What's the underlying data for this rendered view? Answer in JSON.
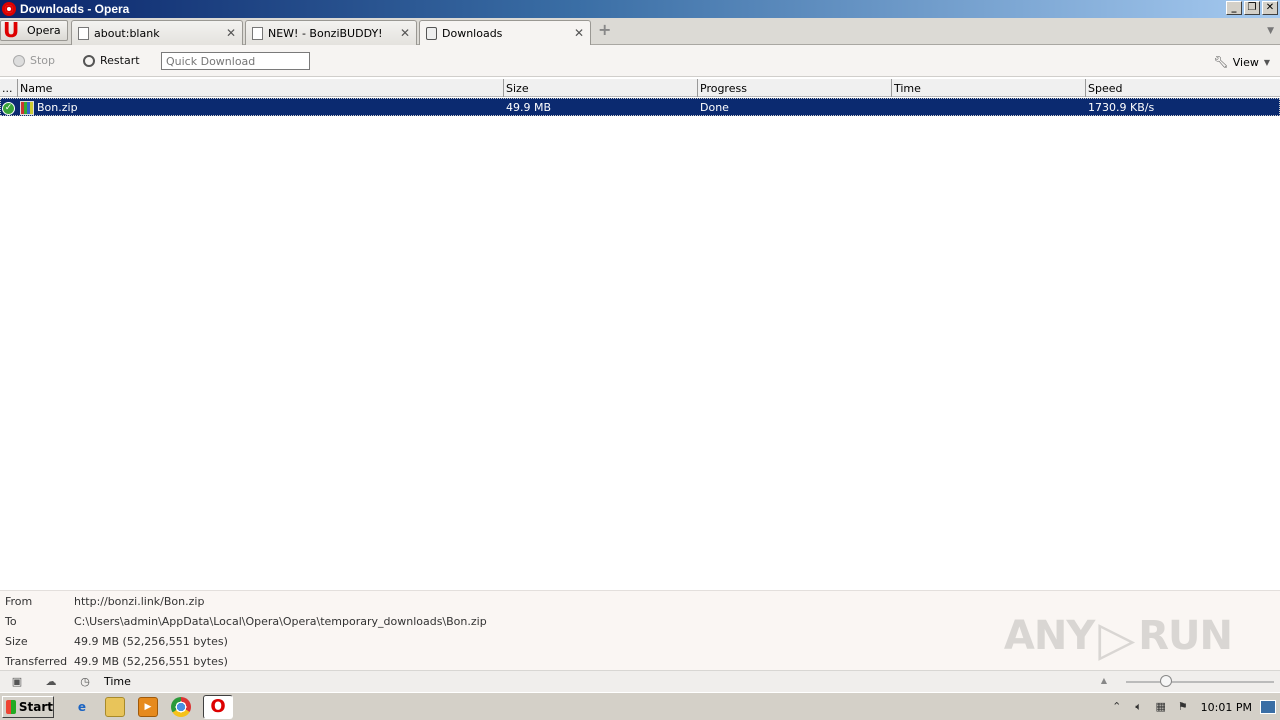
{
  "window": {
    "title": "Downloads - Opera"
  },
  "menu": {
    "label": "Opera"
  },
  "tabs": [
    {
      "label": "about:blank",
      "icon": "page-icon",
      "active": false
    },
    {
      "label": "NEW! - BonziBUDDY!",
      "icon": "page-icon",
      "active": false
    },
    {
      "label": "Downloads",
      "icon": "downloads-icon",
      "active": true
    }
  ],
  "toolbar": {
    "stop_label": "Stop",
    "restart_label": "Restart",
    "quick_placeholder": "Quick Download",
    "view_label": "View"
  },
  "list": {
    "columns": [
      "...",
      "Name",
      "Size",
      "Progress",
      "Time",
      "Speed"
    ],
    "rows": [
      {
        "name": "Bon.zip",
        "size": "49.9 MB",
        "progress": "Done",
        "time": "",
        "speed": "1730.9 KB/s"
      }
    ]
  },
  "details": {
    "from_label": "From",
    "from_value": "http://bonzi.link/Bon.zip",
    "to_label": "To",
    "to_value": "C:\\Users\\admin\\AppData\\Local\\Opera\\Opera\\temporary_downloads\\Bon.zip",
    "size_label": "Size",
    "size_value": "49.9 MB (52,256,551 bytes)",
    "transferred_label": "Transferred",
    "transferred_value": "49.9 MB (52,256,551 bytes)"
  },
  "watermark": {
    "left": "ANY",
    "right": "RUN"
  },
  "statusbar": {
    "time_label": "Time"
  },
  "taskbar": {
    "start_label": "Start",
    "clock": "10:01 PM"
  },
  "colors": {
    "selection": "#0b2a70",
    "titlebar_start": "#0a246a",
    "opera_red": "#dd0000"
  }
}
